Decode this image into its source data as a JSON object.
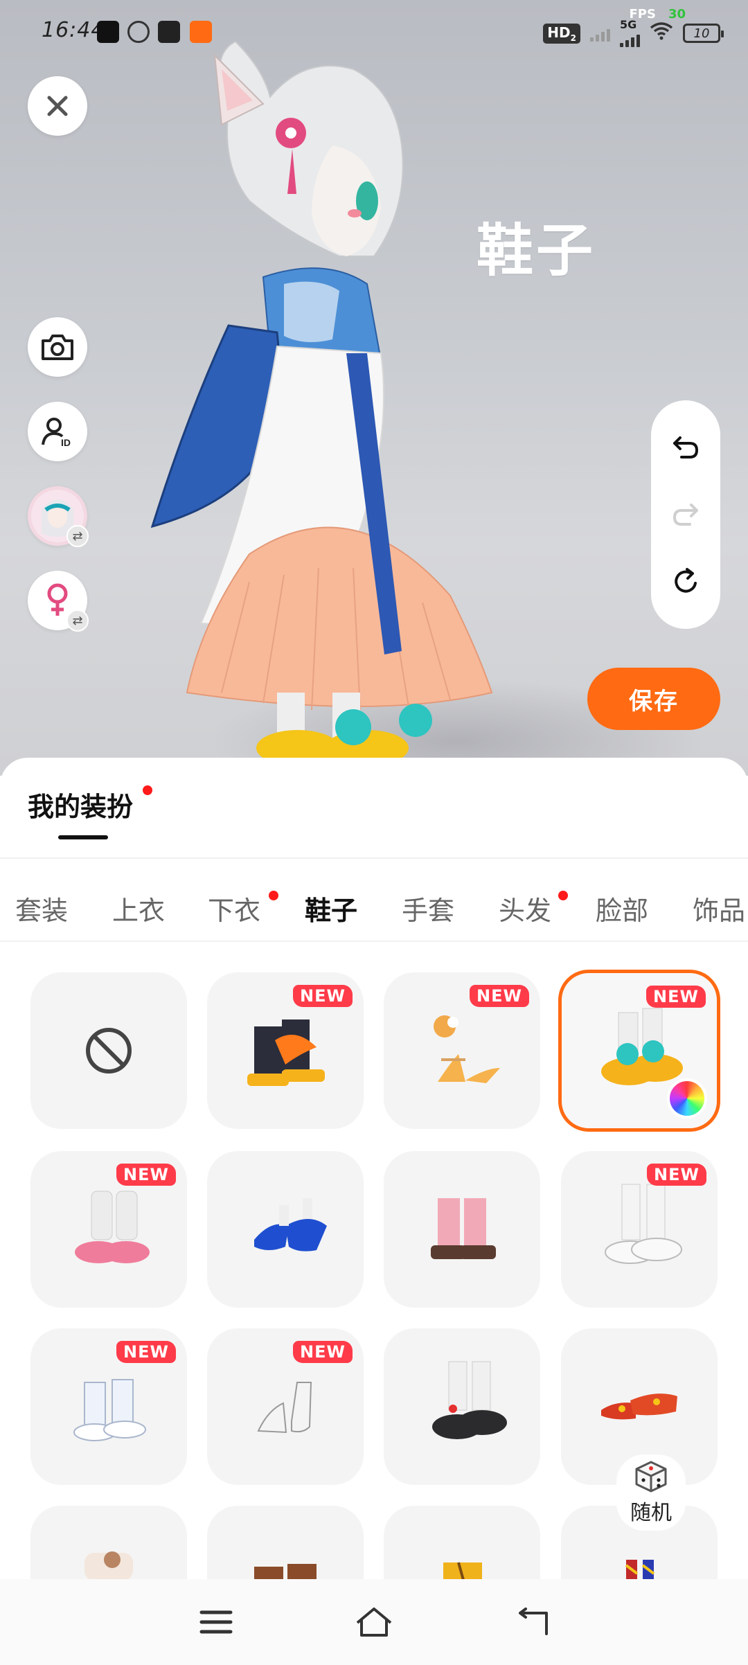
{
  "status_bar": {
    "time": "16:44",
    "hd_label": "HD",
    "hd_sub": "2",
    "network_label": "5G",
    "battery": "10",
    "fps_label": "FPS",
    "fps_value": "30"
  },
  "scene": {
    "title": "鞋子",
    "save_label": "保存"
  },
  "panel": {
    "tab_label": "我的装扮",
    "categories": [
      {
        "label": "套装",
        "has_dot": false,
        "active": false
      },
      {
        "label": "上衣",
        "has_dot": false,
        "active": false
      },
      {
        "label": "下衣",
        "has_dot": true,
        "active": false
      },
      {
        "label": "鞋子",
        "has_dot": false,
        "active": true
      },
      {
        "label": "手套",
        "has_dot": false,
        "active": false
      },
      {
        "label": "头发",
        "has_dot": true,
        "active": false
      },
      {
        "label": "脸部",
        "has_dot": false,
        "active": false
      },
      {
        "label": "饰品",
        "has_dot": false,
        "active": false
      }
    ],
    "new_badge_label": "NEW",
    "items": [
      {
        "name": "none",
        "new": false,
        "selected": false
      },
      {
        "name": "black-orange-flame-boots",
        "new": true,
        "selected": false
      },
      {
        "name": "orange-fox-sandals",
        "new": true,
        "selected": false
      },
      {
        "name": "yellow-fish-sneakers",
        "new": true,
        "selected": true
      },
      {
        "name": "pink-ruffle-leg-warmers",
        "new": true,
        "selected": false
      },
      {
        "name": "blue-heels",
        "new": false,
        "selected": false
      },
      {
        "name": "pink-lace-up-boots",
        "new": false,
        "selected": false
      },
      {
        "name": "white-socks-sneakers",
        "new": true,
        "selected": false
      },
      {
        "name": "white-frilly-boots",
        "new": true,
        "selected": false
      },
      {
        "name": "glass-heels",
        "new": true,
        "selected": false
      },
      {
        "name": "black-bow-shoes",
        "new": false,
        "selected": false
      },
      {
        "name": "red-embroidered-shoes",
        "new": false,
        "selected": false
      },
      {
        "name": "bear-fur-boots",
        "new": false,
        "selected": false
      },
      {
        "name": "brown-boots",
        "new": false,
        "selected": false
      },
      {
        "name": "yellow-ankle-boots",
        "new": false,
        "selected": false
      },
      {
        "name": "red-patterned-socks",
        "new": false,
        "selected": false
      }
    ],
    "random_label": "随机"
  },
  "colors": {
    "accent": "#ff6a12",
    "badge_red": "#ff3b49",
    "dot_red": "#ff1b1b"
  }
}
